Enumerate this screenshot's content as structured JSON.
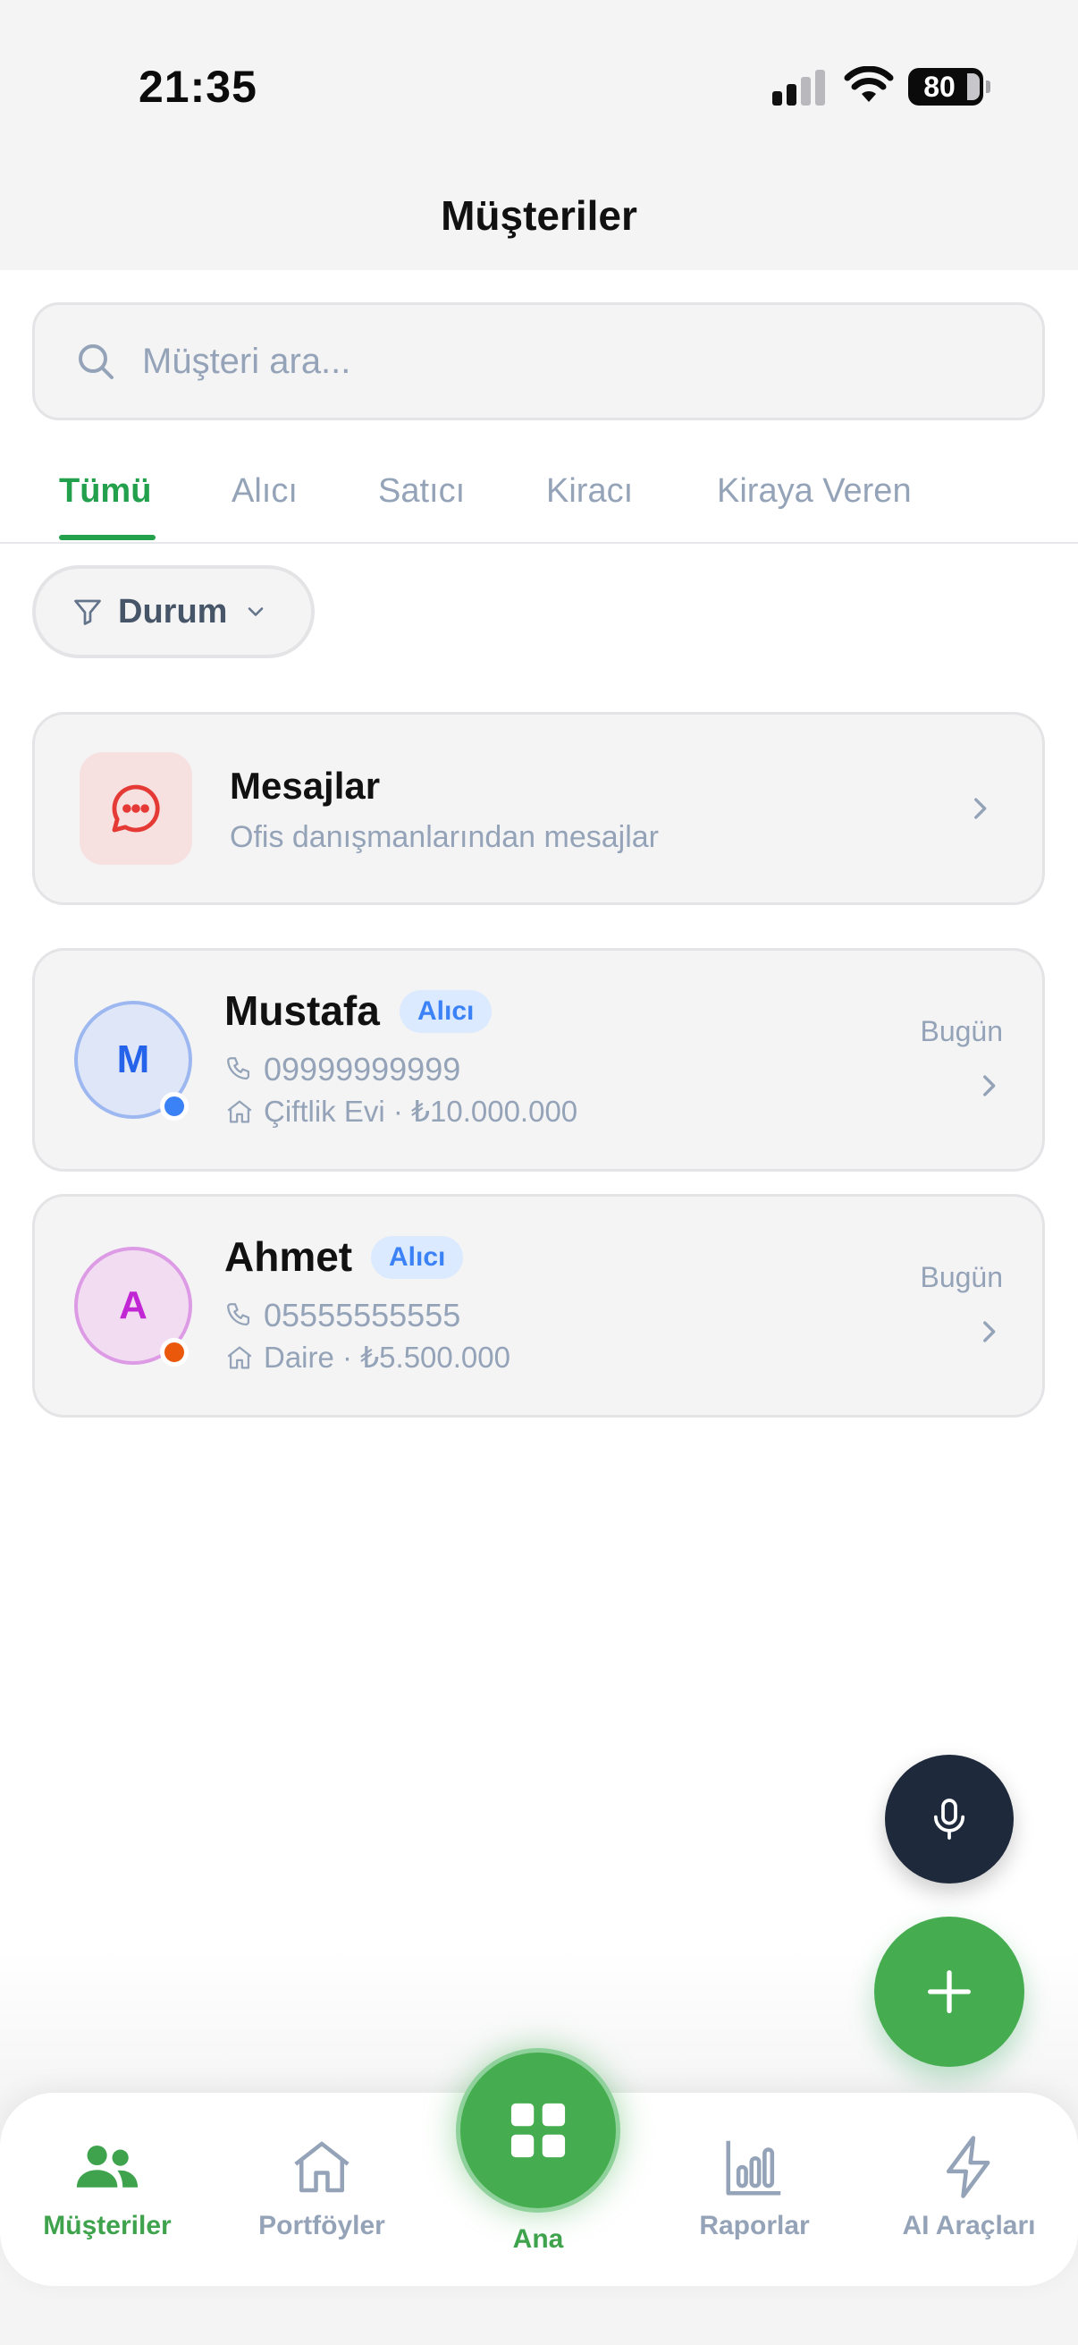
{
  "status_bar": {
    "time": "21:35",
    "battery": "80"
  },
  "header": {
    "title": "Müşteriler"
  },
  "search": {
    "placeholder": "Müşteri ara..."
  },
  "tabs": [
    {
      "label": "Tümü",
      "active": true
    },
    {
      "label": "Alıcı"
    },
    {
      "label": "Satıcı"
    },
    {
      "label": "Kiracı"
    },
    {
      "label": "Kiraya Veren"
    }
  ],
  "filter": {
    "label": "Durum"
  },
  "messages": {
    "title": "Mesajlar",
    "subtitle": "Ofis danışmanlarından mesajlar"
  },
  "customers": [
    {
      "initial": "M",
      "name": "Mustafa",
      "badge": "Alıcı",
      "phone": "09999999999",
      "property": "Çiftlik Evi · ₺10.000.000",
      "date": "Bugün",
      "avatar_bg": "#dfe6f7",
      "avatar_border": "#9db8f0",
      "avatar_color": "#2563eb",
      "dot_color": "#3b82f6"
    },
    {
      "initial": "A",
      "name": "Ahmet",
      "badge": "Alıcı",
      "phone": "05555555555",
      "property": "Daire · ₺5.500.000",
      "date": "Bugün",
      "avatar_bg": "#f2dcf2",
      "avatar_border": "#dc9be4",
      "avatar_color": "#c026d3",
      "dot_color": "#ea580c"
    }
  ],
  "nav": {
    "items": [
      {
        "label": "Müşteriler",
        "icon": "users-icon",
        "active": true
      },
      {
        "label": "Portföyler",
        "icon": "home-icon"
      },
      {
        "label": "Ana",
        "icon": "grid-icon"
      },
      {
        "label": "Raporlar",
        "icon": "bar-chart-icon"
      },
      {
        "label": "AI Araçları",
        "icon": "lightning-icon"
      }
    ]
  },
  "colors": {
    "accent": "#22a04b",
    "fab_dark": "#1e293b",
    "fab_green": "#45ad4f"
  }
}
